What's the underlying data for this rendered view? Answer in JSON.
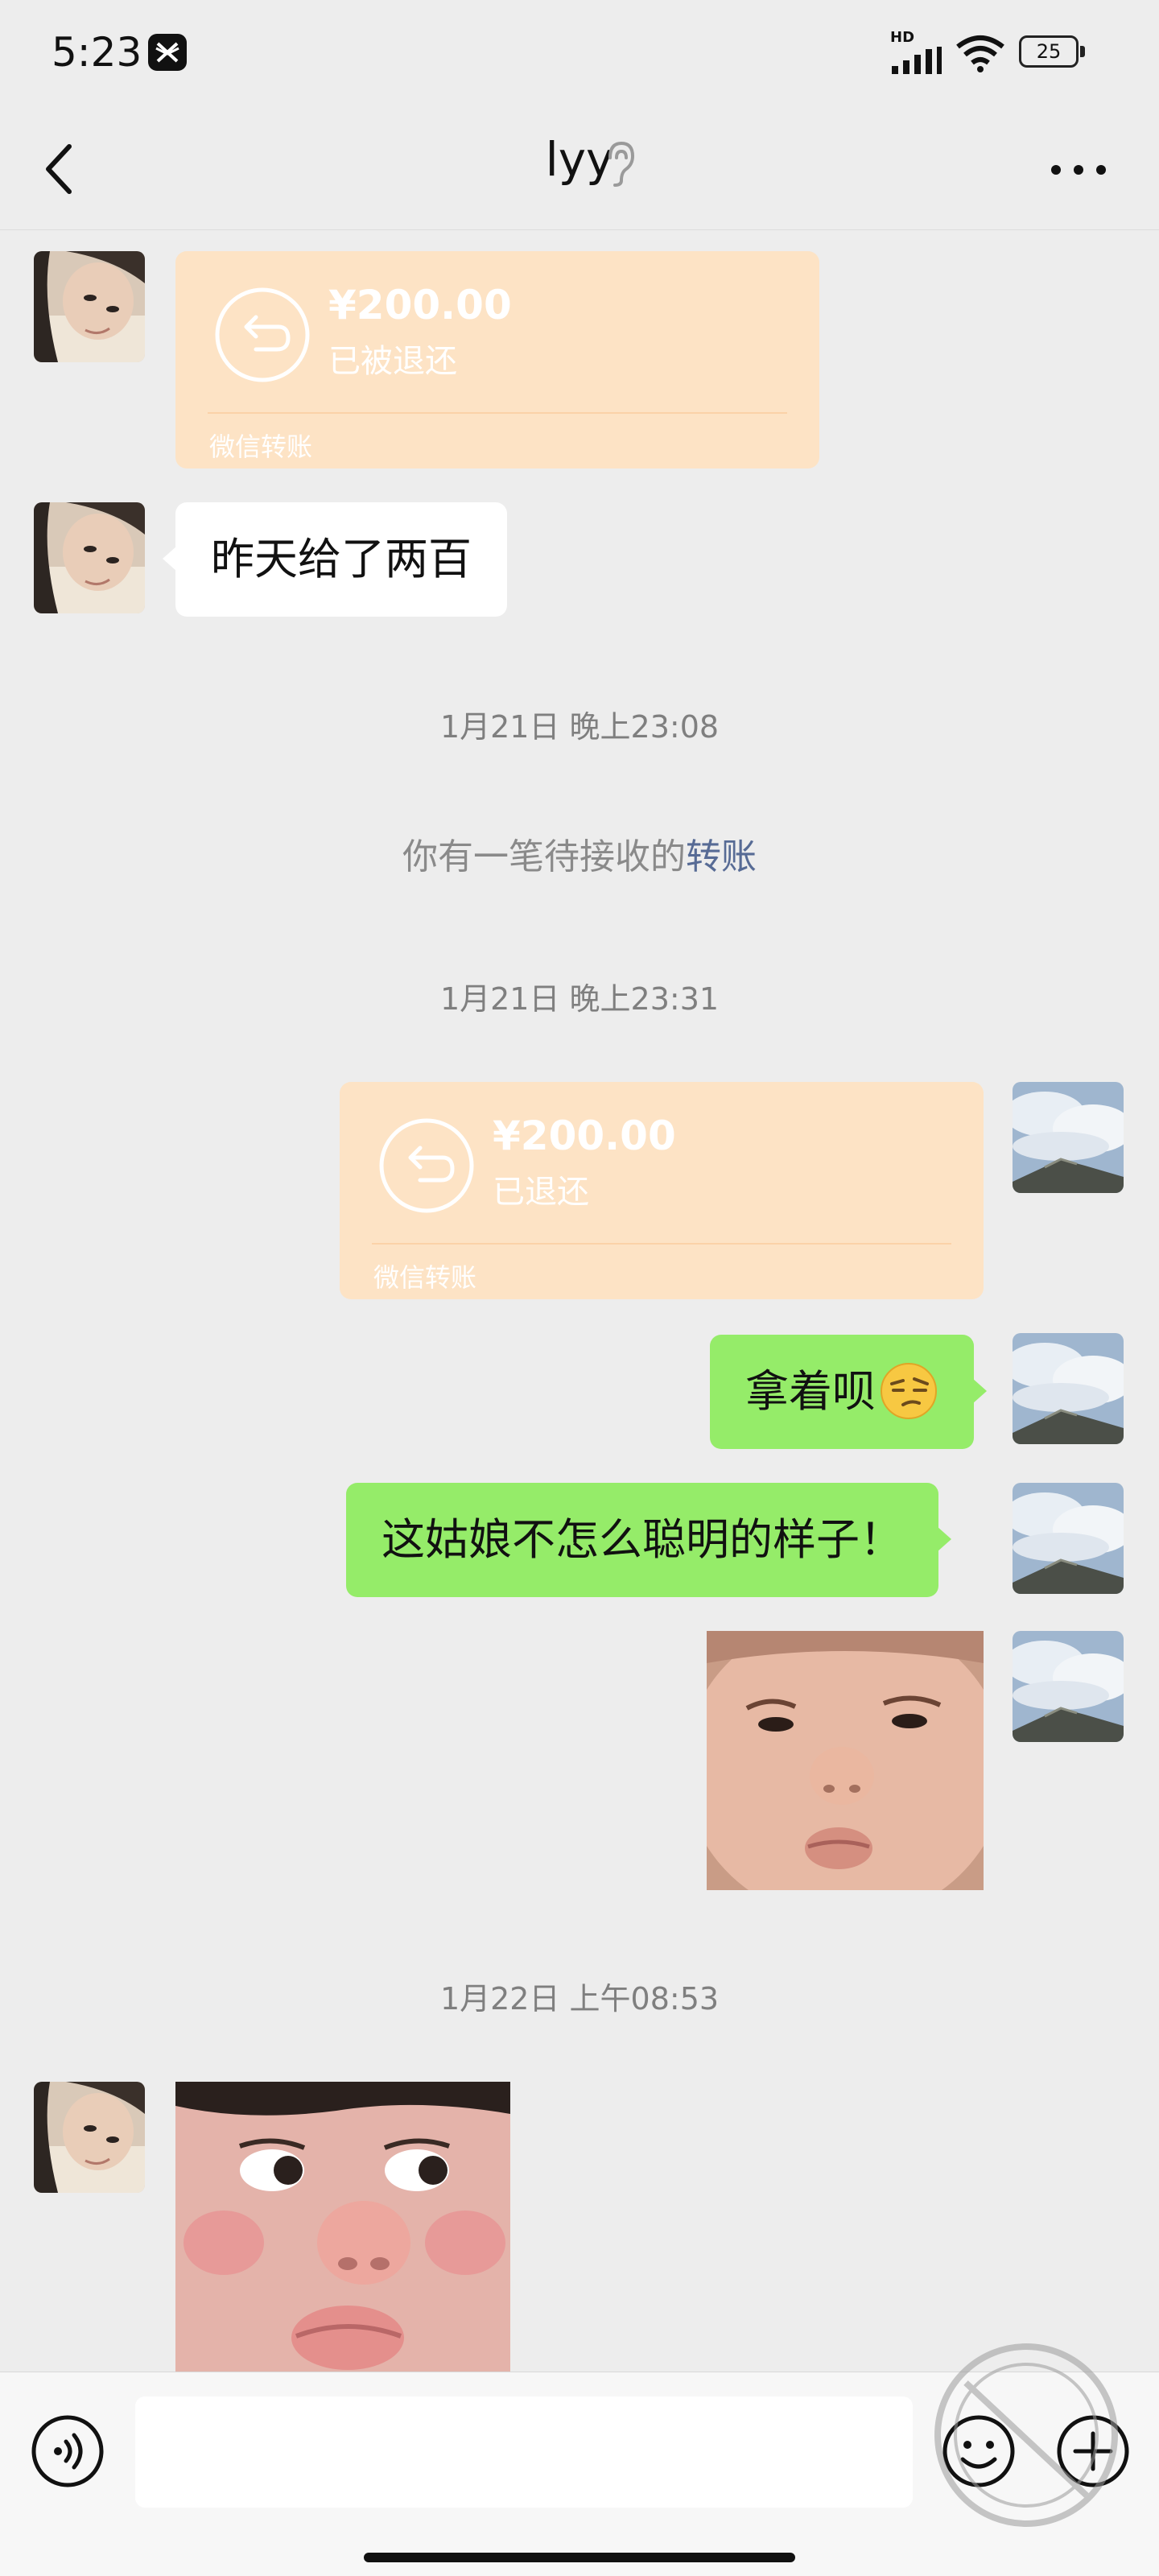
{
  "status_bar": {
    "time": "5:23",
    "network": "HD",
    "battery": "25"
  },
  "header": {
    "title": "lyy"
  },
  "messages": {
    "transfer_in": {
      "amount": "¥200.00",
      "status": "已被退还",
      "brand": "微信转账"
    },
    "text_in_1": "昨天给了两百",
    "time_1": "1月21日 晚上23:08",
    "system_note": {
      "prefix": "你有一笔待接收的",
      "link": "转账"
    },
    "time_2": "1月21日 晚上23:31",
    "transfer_out": {
      "amount": "¥200.00",
      "status": "已退还",
      "brand": "微信转账"
    },
    "text_out_1": "拿着呗",
    "text_out_2": "这姑娘不怎么聪明的样子！",
    "time_3": "1月22日 上午08:53"
  },
  "colors": {
    "background": "#ededed",
    "bubble_green": "#95ec69",
    "transfer_card": "#fde3c5",
    "link": "#576b95"
  },
  "icons": [
    "capcut-icon",
    "signal-icon",
    "wifi-icon",
    "battery-icon",
    "back-chevron-icon",
    "ear-icon",
    "more-dots-icon",
    "transfer-return-icon",
    "voice-icon",
    "emoji-icon",
    "plus-icon"
  ]
}
